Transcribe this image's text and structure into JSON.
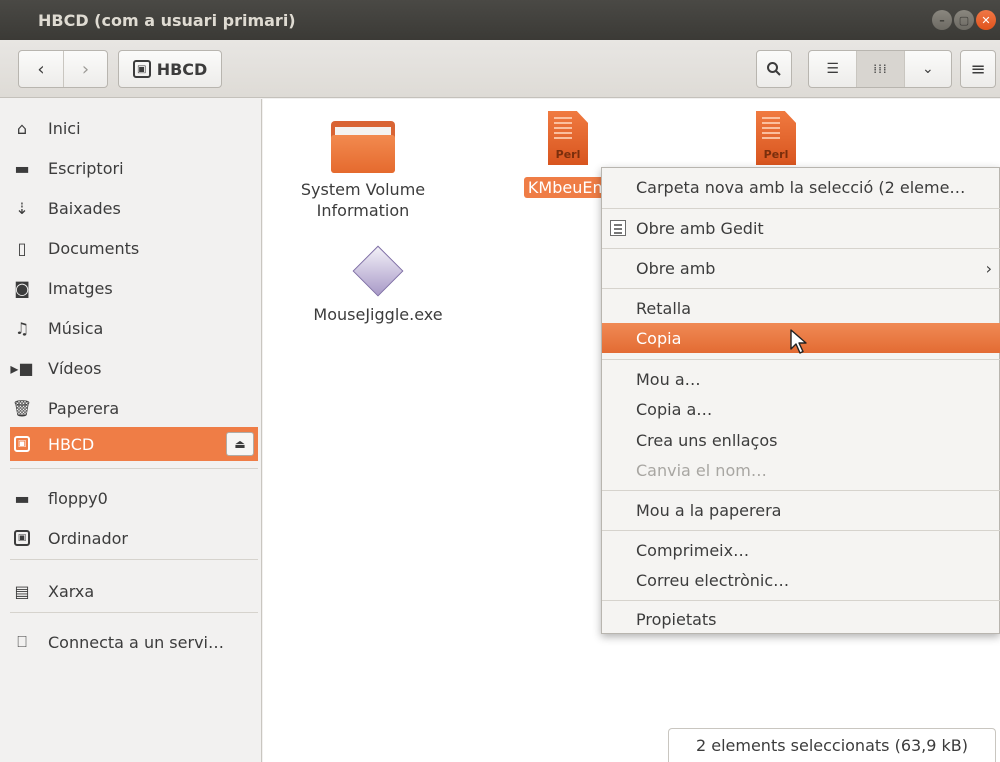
{
  "window": {
    "title": "HBCD (com a usuari primari)"
  },
  "toolbar": {
    "back_icon": "chevron-left-icon",
    "forward_icon": "chevron-right-icon",
    "path_label": "HBCD",
    "icons": [
      "search-icon",
      "list-view-icon",
      "grid-view-icon",
      "chevron-down-icon",
      "hamburger-menu-icon"
    ]
  },
  "sidebar": {
    "items": [
      {
        "label": "Inici",
        "icon": "home-icon"
      },
      {
        "label": "Escriptori",
        "icon": "desktop-folder-icon"
      },
      {
        "label": "Baixades",
        "icon": "download-icon"
      },
      {
        "label": "Documents",
        "icon": "document-icon"
      },
      {
        "label": "Imatges",
        "icon": "camera-icon"
      },
      {
        "label": "Música",
        "icon": "music-icon"
      },
      {
        "label": "Vídeos",
        "icon": "video-icon"
      },
      {
        "label": "Paperera",
        "icon": "trash-icon"
      },
      {
        "label": "HBCD",
        "icon": "drive-icon",
        "selected": true
      },
      {
        "label": "floppy0",
        "icon": "floppy-icon"
      },
      {
        "label": "Ordinador",
        "icon": "computer-drive-icon"
      },
      {
        "label": "Xarxa",
        "icon": "network-icon"
      },
      {
        "label": "Connecta a un servi…",
        "icon": "server-icon"
      }
    ]
  },
  "files": [
    {
      "name_line1": "System Volume",
      "name_line2": "Information",
      "type": "folder"
    },
    {
      "name": "KMbeuEm",
      "type": "perl",
      "tag": "Perl",
      "selected": true
    },
    {
      "name": "",
      "type": "perl",
      "tag": "Perl"
    },
    {
      "name": "MouseJiggle.exe",
      "type": "executable"
    }
  ],
  "context_menu": {
    "items": [
      {
        "label": "Carpeta nova amb la selecció (2 eleme…"
      },
      {
        "label": "Obre amb Gedit",
        "icon": "gedit-icon"
      },
      {
        "label": "Obre amb",
        "has_submenu": true
      },
      {
        "label": "Retalla"
      },
      {
        "label": "Copia",
        "active": true
      },
      {
        "label": "Mou a…"
      },
      {
        "label": "Copia a…"
      },
      {
        "label": "Crea uns enllaços"
      },
      {
        "label": "Canvia el nom…",
        "disabled": true
      },
      {
        "label": "Mou a la paperera"
      },
      {
        "label": "Comprimeix…"
      },
      {
        "label": "Correu electrònic…"
      },
      {
        "label": "Propietats"
      }
    ]
  },
  "status": {
    "text": "2 elements seleccionats (63,9 kB)"
  },
  "colors": {
    "accent": "#ef7d46",
    "titlebar": "#3b3a36",
    "close": "#e0531c"
  }
}
